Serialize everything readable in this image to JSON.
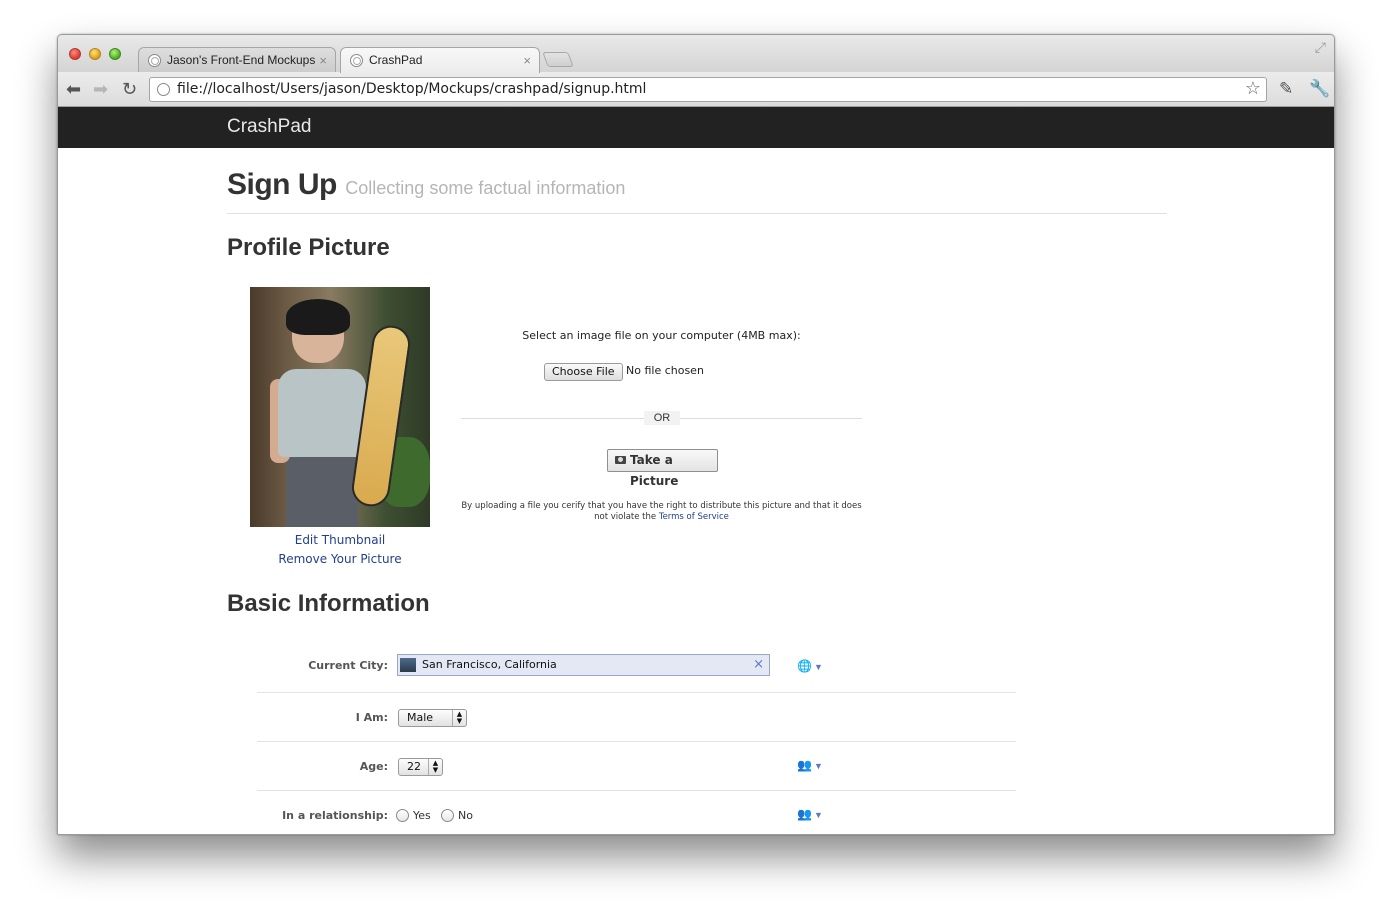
{
  "browser": {
    "tabs": [
      {
        "label": "Jason's Front-End Mockups",
        "close": "×"
      },
      {
        "label": "CrashPad",
        "close": "×"
      }
    ],
    "url": "file://localhost/Users/jason/Desktop/Mockups/crashpad/signup.html",
    "icons": [
      "back-icon",
      "forward-icon",
      "reload-icon",
      "bookmark-star-icon",
      "extension-icon",
      "wrench-icon",
      "fullscreen-icon"
    ]
  },
  "app": {
    "brand": "CrashPad"
  },
  "header": {
    "title": "Sign Up",
    "subtitle": "Collecting some factual information"
  },
  "profile": {
    "section_title": "Profile Picture",
    "edit_thumbnail": "Edit Thumbnail",
    "remove_picture": "Remove Your Picture",
    "upload_prompt": "Select an image file on your computer (4MB max):",
    "choose_file": "Choose File",
    "no_file": "No file chosen",
    "or_label": "OR",
    "take_picture": "Take a Picture",
    "legal_text": "By uploading a file you cerify that you have the right to distribute this picture and that it does not violate the",
    "terms_link": "Terms of Service"
  },
  "basic": {
    "section_title": "Basic Information",
    "current_city_label": "Current City:",
    "current_city_value": "San Francisco, California",
    "token_remove": "×",
    "i_am_label": "I Am:",
    "i_am_value": "Male",
    "age_label": "Age:",
    "age_value": "22",
    "relationship_label": "In a relationship:",
    "yes_label": "Yes",
    "no_label": "No"
  },
  "colors": {
    "appbar": "#222222",
    "link": "#23408e",
    "token_bg": "#e3e8f4"
  }
}
